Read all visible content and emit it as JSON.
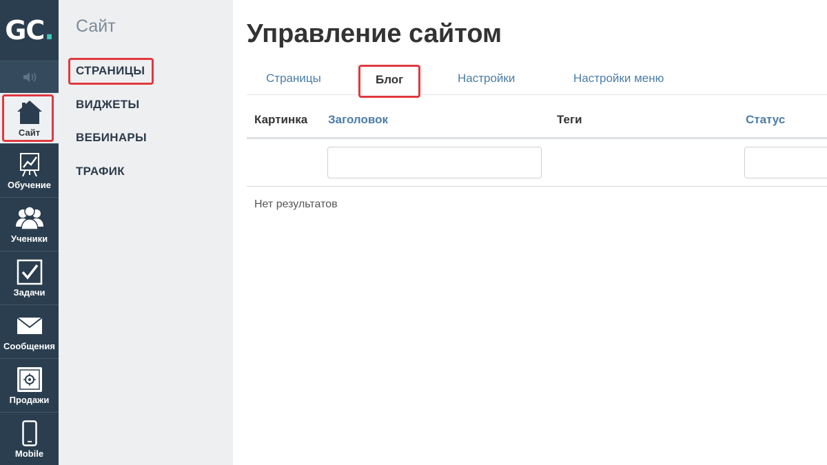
{
  "rail": {
    "logo": {
      "letters": "GC",
      "dot": "."
    },
    "sound_icon": "speaker-icon",
    "items": [
      {
        "label": "Сайт",
        "icon": "home-icon",
        "active": true
      },
      {
        "label": "Обучение",
        "icon": "chart-board-icon"
      },
      {
        "label": "Ученики",
        "icon": "users-icon"
      },
      {
        "label": "Задачи",
        "icon": "checkbox-icon"
      },
      {
        "label": "Сообщения",
        "icon": "envelope-icon"
      },
      {
        "label": "Продажи",
        "icon": "safe-icon"
      },
      {
        "label": "Mobile",
        "icon": "phone-icon"
      }
    ]
  },
  "subnav": {
    "title": "Сайт",
    "items": [
      {
        "label": "СТРАНИЦЫ",
        "active": true
      },
      {
        "label": "ВИДЖЕТЫ"
      },
      {
        "label": "ВЕБИНАРЫ"
      },
      {
        "label": "ТРАФИК"
      }
    ]
  },
  "main": {
    "title": "Управление сайтом",
    "tabs": [
      {
        "label": "Страницы"
      },
      {
        "label": "Блог",
        "active": true
      },
      {
        "label": "Настройки"
      },
      {
        "label": "Настройки меню"
      }
    ],
    "table": {
      "columns": [
        "Картинка",
        "Заголовок",
        "Теги",
        "Статус"
      ],
      "empty_text": "Нет результатов"
    }
  },
  "colors": {
    "rail_bg": "#2b3e4f",
    "accent_teal": "#3ec9b8",
    "highlight_red": "#e0393e",
    "link_blue": "#4a7ca8"
  }
}
